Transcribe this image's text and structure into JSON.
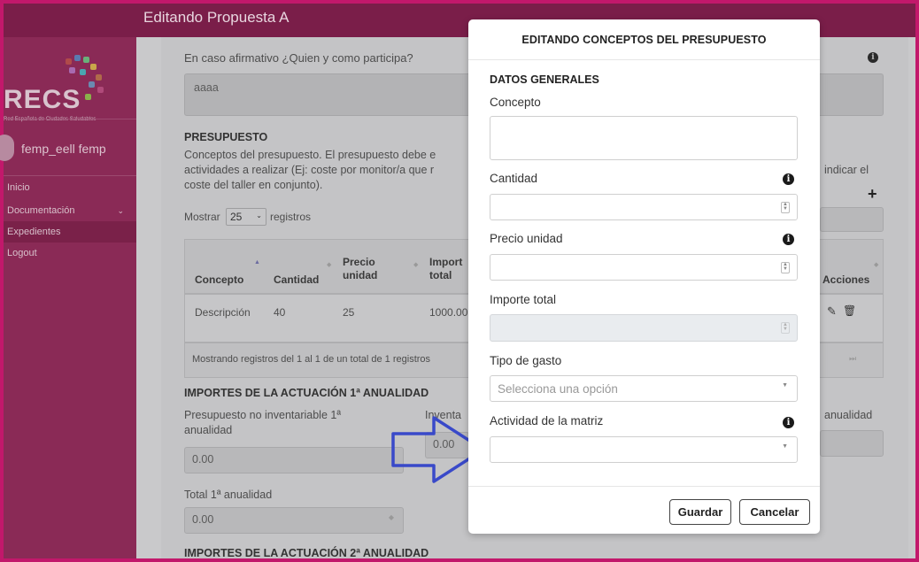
{
  "topbar": {
    "title": "Editando Propuesta A"
  },
  "sidebar": {
    "logo_text": "RECS",
    "logo_sub": "Red Española de Ciudades Saludables",
    "user_name": "femp_eell femp",
    "items": [
      {
        "label": "Inicio"
      },
      {
        "label": "Documentación"
      },
      {
        "label": "Expedientes"
      },
      {
        "label": "Logout"
      }
    ]
  },
  "background": {
    "participation_label": "En caso afirmativo ¿Quien y como participa?",
    "participation_value": "aaaa",
    "presupuesto_heading": "PRESUPUESTO",
    "presupuesto_desc_1": "Conceptos del presupuesto. El presupuesto debe e",
    "presupuesto_desc_2": "actividades a realizar (Ej: coste por monitor/a que r",
    "presupuesto_desc_3": "coste del taller en conjunto).",
    "presupuesto_desc_right": "indicar el",
    "show_label": "Mostrar",
    "show_value": "25",
    "records_label": "registros",
    "table": {
      "headers": [
        "Concepto",
        "Cantidad",
        "Precio unidad",
        "Import total",
        "Acciones"
      ],
      "row": [
        "Descripción",
        "40",
        "25",
        "1000.00"
      ]
    },
    "table_footer": "Mostrando registros del 1 al 1 de un total de 1 registros",
    "importes_1_heading": "IMPORTES DE LA ACTUACIÓN 1ª ANUALIDAD",
    "no_inventariable_label": "Presupuesto no inventariable 1ª anualidad",
    "no_inventariable_value": "0.00",
    "inventariable_label": "Inventa",
    "inventariable_value": "0.00",
    "anualidad_right": "anualidad",
    "total_label": "Total 1ª anualidad",
    "total_value": "0.00",
    "importes_2_heading": "IMPORTES DE LA ACTUACIÓN 2ª ANUALIDAD"
  },
  "modal": {
    "title": "EDITANDO CONCEPTOS DEL PRESUPUESTO",
    "section": "DATOS GENERALES",
    "fields": {
      "concepto": {
        "label": "Concepto",
        "value": ""
      },
      "cantidad": {
        "label": "Cantidad",
        "value": ""
      },
      "precio_unidad": {
        "label": "Precio unidad",
        "value": ""
      },
      "importe_total": {
        "label": "Importe total",
        "value": ""
      },
      "tipo_gasto": {
        "label": "Tipo de gasto",
        "placeholder": "Selecciona una opción"
      },
      "actividad": {
        "label": "Actividad de la matriz",
        "value": ""
      }
    },
    "buttons": {
      "save": "Guardar",
      "cancel": "Cancelar"
    }
  },
  "colors": {
    "frame_border": "#c2186b",
    "topbar": "#7a1e49",
    "sidebar": "#8a2a56",
    "arrow": "#3949c9"
  }
}
